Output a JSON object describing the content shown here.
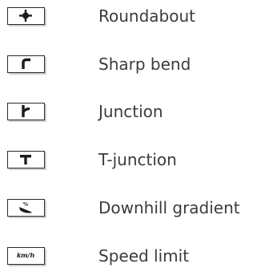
{
  "legend": {
    "items": [
      {
        "icon": "roundabout-icon",
        "label": "Roundabout"
      },
      {
        "icon": "sharp-bend-icon",
        "label": "Sharp bend"
      },
      {
        "icon": "junction-icon",
        "label": "Junction"
      },
      {
        "icon": "t-junction-icon",
        "label": "T-junction"
      },
      {
        "icon": "downhill-gradient-icon",
        "label": "Downhill gradient",
        "icon_text": "%"
      },
      {
        "icon": "speed-limit-icon",
        "label": "Speed limit",
        "icon_text": "km/h"
      }
    ]
  }
}
